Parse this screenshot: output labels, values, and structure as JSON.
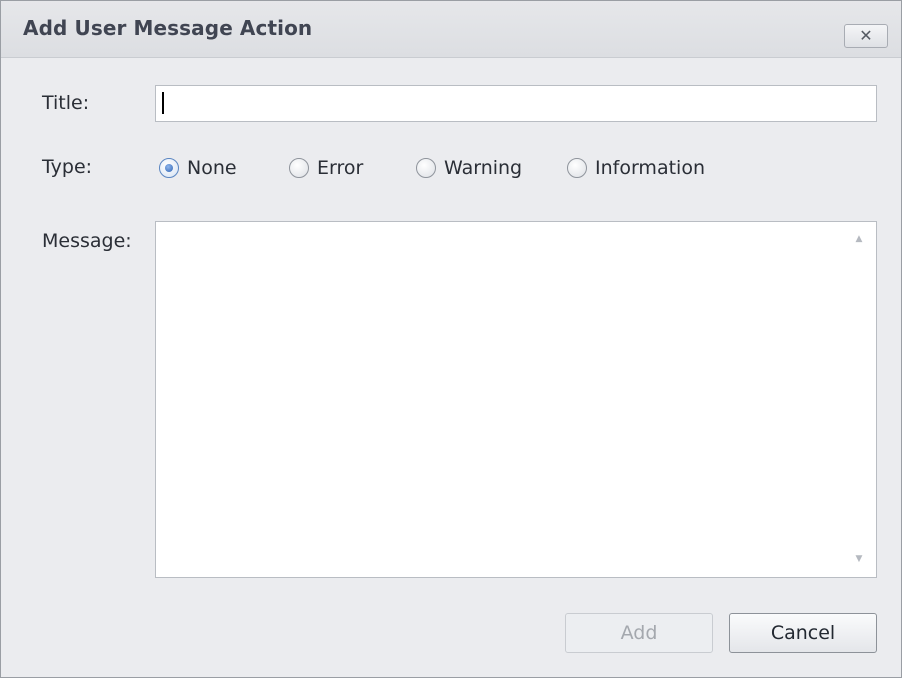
{
  "dialog": {
    "title": "Add User Message Action",
    "close_glyph": "✕"
  },
  "form": {
    "title_label": "Title:",
    "title_value": "",
    "type_label": "Type:",
    "type_options": [
      "None",
      "Error",
      "Warning",
      "Information"
    ],
    "type_selected": "None",
    "message_label": "Message:",
    "message_value": ""
  },
  "buttons": {
    "add_label": "Add",
    "add_enabled": false,
    "cancel_label": "Cancel"
  },
  "icons": {
    "close": "close-icon",
    "scroll_up": "scroll-up-icon",
    "scroll_down": "scroll-down-icon"
  },
  "colors": {
    "dialog_bg": "#ebecef",
    "title_text": "#404552",
    "radio_accent": "#2f64b5",
    "disabled_text": "#a4a8ae"
  }
}
